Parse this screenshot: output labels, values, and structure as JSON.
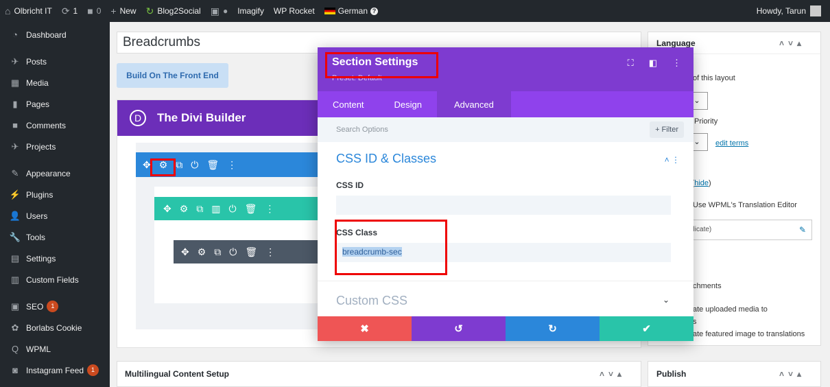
{
  "adminbar": {
    "site": "Olbricht IT",
    "updates": "1",
    "comments": "0",
    "new": "New",
    "blog2social": "Blog2Social",
    "imagify": "Imagify",
    "wp_rocket": "WP Rocket",
    "language": "German",
    "howdy": "Howdy, Tarun"
  },
  "sidebar": {
    "items": [
      {
        "label": "Dashboard",
        "icon": "dashboard-icon"
      },
      {
        "label": "Posts",
        "icon": "pin-icon"
      },
      {
        "label": "Media",
        "icon": "media-icon"
      },
      {
        "label": "Pages",
        "icon": "pages-icon"
      },
      {
        "label": "Comments",
        "icon": "comment-icon"
      },
      {
        "label": "Projects",
        "icon": "pin-icon"
      },
      {
        "label": "Appearance",
        "icon": "brush-icon"
      },
      {
        "label": "Plugins",
        "icon": "plug-icon"
      },
      {
        "label": "Users",
        "icon": "users-icon"
      },
      {
        "label": "Tools",
        "icon": "wrench-icon"
      },
      {
        "label": "Settings",
        "icon": "settings-icon"
      },
      {
        "label": "Custom Fields",
        "icon": "table-icon"
      },
      {
        "label": "SEO",
        "icon": "yoast-icon",
        "badge": "1"
      },
      {
        "label": "Borlabs Cookie",
        "icon": "cookie-icon"
      },
      {
        "label": "WPML",
        "icon": "wpml-icon"
      },
      {
        "label": "Instagram Feed",
        "icon": "camera-icon",
        "badge": "1"
      }
    ]
  },
  "main": {
    "title_value": "Breadcrumbs",
    "build_front": "Build On The Front End",
    "divi_title": "The Divi Builder",
    "divi_logo": "D",
    "multilingual": "Multilingual Content Setup"
  },
  "modal": {
    "title": "Section Settings",
    "preset": "Preset: Default",
    "tabs": [
      "Content",
      "Design",
      "Advanced"
    ],
    "active_tab": "Advanced",
    "search_placeholder": "Search Options",
    "filter": "+ Filter",
    "toggle": "CSS ID & Classes",
    "css_id_label": "CSS ID",
    "css_id_value": "",
    "css_class_label": "CSS Class",
    "css_class_value": "breadcrumb-sec",
    "custom_css": "Custom CSS",
    "colors": {
      "discard": "#ef5555",
      "undo": "#7e3bd0",
      "redo": "#2b87da",
      "save": "#29c4a9"
    }
  },
  "right": {
    "language_title": "Language",
    "of_layout": "of this layout",
    "priority": "Priority",
    "edit_terms": "edit terms",
    "hide_prefix": "s (",
    "hide": "hide",
    "hide_suffix": ")",
    "translation_editor": "Use WPML's Translation Editor",
    "duplicate": "plicate)",
    "attachments": "chments",
    "uploaded": "ate uploaded media to",
    "s_char": "s",
    "featured": "ate featured image to translations",
    "publish": "Publish"
  }
}
